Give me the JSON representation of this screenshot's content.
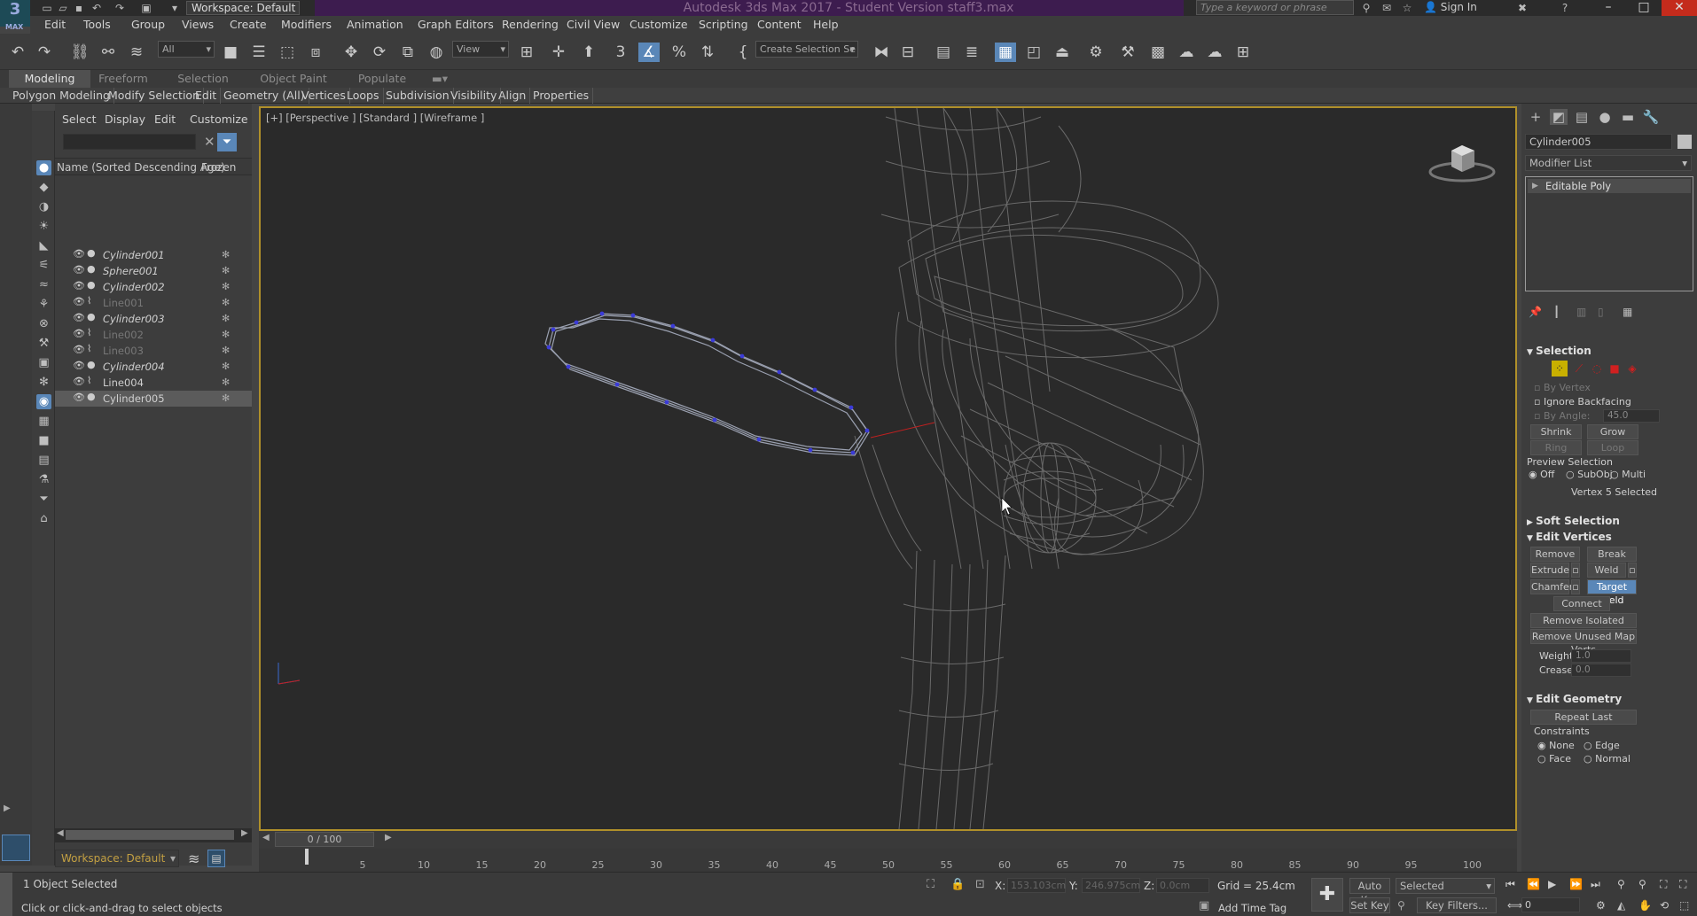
{
  "title_bar": {
    "app_title": "Autodesk 3ds Max 2017 - Student Version    staff3.max",
    "logo_text": "3",
    "logo_sub": "MAX",
    "workspace": "Workspace: Default",
    "search_placeholder": "Type a keyword or phrase",
    "sign_in": "Sign In"
  },
  "menu": [
    "Edit",
    "Tools",
    "Group",
    "Views",
    "Create",
    "Modifiers",
    "Animation",
    "Graph Editors",
    "Rendering",
    "Civil View",
    "Customize",
    "Scripting",
    "Content",
    "Help"
  ],
  "toolbar": {
    "selection_filter": "All",
    "ref_coord": "View",
    "named_selection": "Create Selection Se"
  },
  "ribbon": {
    "tabs": [
      "Modeling",
      "Freeform",
      "Selection",
      "Object Paint",
      "Populate"
    ],
    "active_tab": "Modeling",
    "sub_items": [
      "Polygon Modeling",
      "Modify Selection",
      "Edit",
      "Geometry (All)",
      "Vertices",
      "Loops",
      "Subdivision",
      "Visibility",
      "Align",
      "Properties"
    ]
  },
  "scene_explorer": {
    "tabs": [
      "Select",
      "Display",
      "Edit",
      "Customize"
    ],
    "col_name": "Name (Sorted Descending Age)",
    "col_frozen": "Frozen",
    "rows": [
      {
        "name": "Cylinder001",
        "style": "italic"
      },
      {
        "name": "Sphere001",
        "style": "italic"
      },
      {
        "name": "Cylinder002",
        "style": "italic"
      },
      {
        "name": "Line001",
        "style": "dim"
      },
      {
        "name": "Cylinder003",
        "style": "italic"
      },
      {
        "name": "Line002",
        "style": "dim"
      },
      {
        "name": "Line003",
        "style": "dim"
      },
      {
        "name": "Cylinder004",
        "style": "italic"
      },
      {
        "name": "Line004",
        "style": "normal"
      },
      {
        "name": "Cylinder005",
        "style": "selected"
      }
    ],
    "workspace": "Workspace: Default"
  },
  "viewport": {
    "label": "[+] [Perspective ] [Standard ] [Wireframe ]"
  },
  "timeline": {
    "slider": "0 / 100",
    "ticks": [
      "5",
      "10",
      "15",
      "20",
      "25",
      "30",
      "35",
      "40",
      "45",
      "50",
      "55",
      "60",
      "65",
      "70",
      "75",
      "80",
      "85",
      "90",
      "95",
      "100"
    ]
  },
  "status": {
    "objects_selected": "1 Object Selected",
    "prompt": "Click or click-and-drag to select objects",
    "x_label": "X:",
    "x_value": "153.103cm",
    "y_label": "Y:",
    "y_value": "246.975cm",
    "z_label": "Z:",
    "z_value": "0.0cm",
    "grid": "Grid = 25.4cm",
    "add_time_tag": "Add Time Tag",
    "auto_key": "Auto Key",
    "set_key": "Set Key",
    "selected_dropdown": "Selected",
    "key_filters": "Key Filters...",
    "frame": "0"
  },
  "command_panel": {
    "object_name": "Cylinder005",
    "modifier_list": "Modifier List",
    "stack_item": "Editable Poly",
    "selection": {
      "title": "Selection",
      "by_vertex": "By Vertex",
      "ignore_backfacing": "Ignore Backfacing",
      "by_angle": "By Angle:",
      "by_angle_value": "45.0",
      "shrink": "Shrink",
      "grow": "Grow",
      "ring": "Ring",
      "loop": "Loop",
      "preview_selection": "Preview Selection",
      "off": "Off",
      "subobj": "SubObj",
      "multi": "Multi",
      "status": "Vertex 5 Selected"
    },
    "soft_selection": "Soft Selection",
    "edit_vertices": {
      "title": "Edit Vertices",
      "remove": "Remove",
      "break": "Break",
      "extrude": "Extrude",
      "weld": "Weld",
      "chamfer": "Chamfer",
      "target_weld": "Target Weld",
      "connect": "Connect",
      "remove_isolated": "Remove Isolated Vertices",
      "remove_unused": "Remove Unused Map Verts",
      "weight_label": "Weight:",
      "weight_value": "1.0",
      "crease_label": "Crease:",
      "crease_value": "0.0"
    },
    "edit_geometry": {
      "title": "Edit Geometry",
      "repeat_last": "Repeat Last",
      "constraints": "Constraints",
      "none": "None",
      "edge": "Edge",
      "face": "Face",
      "normal": "Normal"
    }
  },
  "colors": {
    "accent": "#5a87b8",
    "viewport_border": "#b0902a",
    "title_purple": "#3d1c4f",
    "vertex": "#3b3bd8",
    "selection_line": "#c02020"
  }
}
